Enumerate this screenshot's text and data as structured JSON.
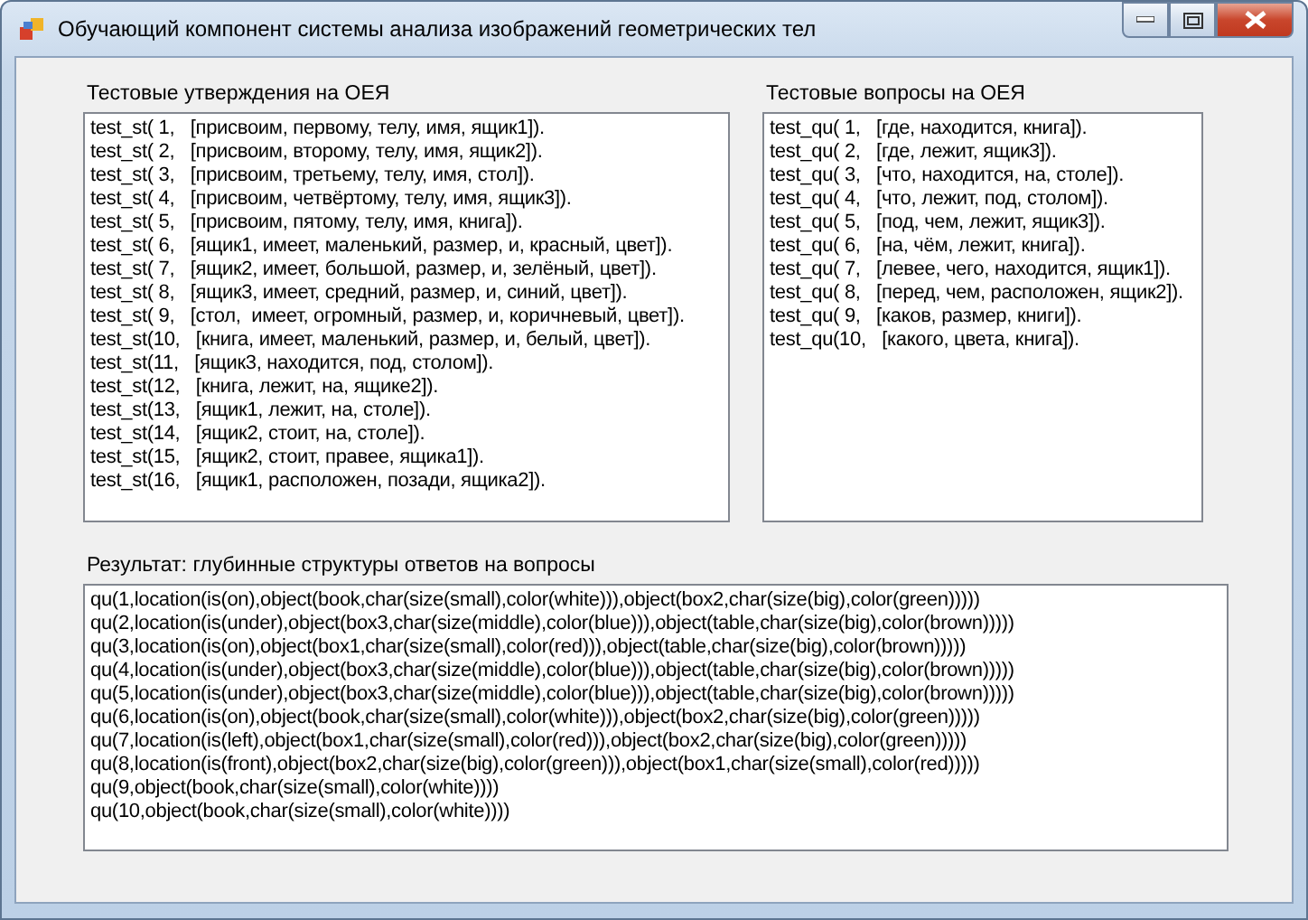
{
  "window": {
    "title": "Обучающий компонент системы анализа изображений геометрических тел"
  },
  "statements": {
    "label": "Тестовые утверждения на ОЕЯ",
    "lines": [
      "test_st( 1,   [присвоим, первому, телу, имя, ящик1]).",
      "test_st( 2,   [присвоим, второму, телу, имя, ящик2]).",
      "test_st( 3,   [присвоим, третьему, телу, имя, стол]).",
      "test_st( 4,   [присвоим, четвёртому, телу, имя, ящик3]).",
      "test_st( 5,   [присвоим, пятому, телу, имя, книга]).",
      "test_st( 6,   [ящик1, имеет, маленький, размер, и, красный, цвет]).",
      "test_st( 7,   [ящик2, имеет, большой, размер, и, зелёный, цвет]).",
      "test_st( 8,   [ящик3, имеет, средний, размер, и, синий, цвет]).",
      "test_st( 9,   [стол,  имеет, огромный, размер, и, коричневый, цвет]).",
      "test_st(10,   [книга, имеет, маленький, размер, и, белый, цвет]).",
      "test_st(11,   [ящик3, находится, под, столом]).",
      "test_st(12,   [книга, лежит, на, ящике2]).",
      "test_st(13,   [ящик1, лежит, на, столе]).",
      "test_st(14,   [ящик2, стоит, на, столе]).",
      "test_st(15,   [ящик2, стоит, правее, ящика1]).",
      "test_st(16,   [ящик1, расположен, позади, ящика2])."
    ]
  },
  "questions": {
    "label": "Тестовые вопросы на ОЕЯ",
    "lines": [
      "test_qu( 1,   [где, находится, книга]).",
      "test_qu( 2,   [где, лежит, ящик3]).",
      "test_qu( 3,   [что, находится, на, столе]).",
      "test_qu( 4,   [что, лежит, под, столом]).",
      "test_qu( 5,   [под, чем, лежит, ящик3]).",
      "test_qu( 6,   [на, чём, лежит, книга]).",
      "test_qu( 7,   [левее, чего, находится, ящик1]).",
      "test_qu( 8,   [перед, чем, расположен, ящик2]).",
      "test_qu( 9,   [каков, размер, книги]).",
      "test_qu(10,   [какого, цвета, книга])."
    ]
  },
  "result": {
    "label": "Результат: глубинные структуры ответов на вопросы",
    "lines": [
      "qu(1,location(is(on),object(book,char(size(small),color(white))),object(box2,char(size(big),color(green)))))",
      "qu(2,location(is(under),object(box3,char(size(middle),color(blue))),object(table,char(size(big),color(brown)))))",
      "qu(3,location(is(on),object(box1,char(size(small),color(red))),object(table,char(size(big),color(brown)))))",
      "qu(4,location(is(under),object(box3,char(size(middle),color(blue))),object(table,char(size(big),color(brown)))))",
      "qu(5,location(is(under),object(box3,char(size(middle),color(blue))),object(table,char(size(big),color(brown)))))",
      "qu(6,location(is(on),object(book,char(size(small),color(white))),object(box2,char(size(big),color(green)))))",
      "qu(7,location(is(left),object(box1,char(size(small),color(red))),object(box2,char(size(big),color(green)))))",
      "qu(8,location(is(front),object(box2,char(size(big),color(green))),object(box1,char(size(small),color(red)))))",
      "qu(9,object(book,char(size(small),color(white))))",
      "qu(10,object(book,char(size(small),color(white))))"
    ]
  }
}
